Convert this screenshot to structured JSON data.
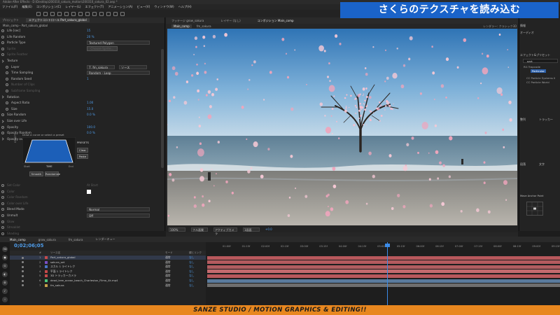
{
  "window": {
    "title": "Adobe After Effects - D:\\Desktop\\200310_sakura_motion\\200310_sakura_02.aep *"
  },
  "banner": {
    "text": "さくらのテクスチャを読み込む"
  },
  "menu": {
    "items": [
      "ファイル(F)",
      "編集(E)",
      "コンポジション(C)",
      "レイヤー(L)",
      "エフェクト(T)",
      "アニメーション(A)",
      "ビュー(V)",
      "ウィンドウ(W)",
      "ヘルプ(H)"
    ]
  },
  "effect_controls": {
    "tabs": [
      "プロジェクト",
      "エフェクトコントロール Part_sakura_global"
    ],
    "path": "Main_comp・Part_sakura_global",
    "rows": [
      {
        "label": "Life [sec]",
        "value": "15",
        "indent": 1
      },
      {
        "label": "Life Random",
        "value": "20 %",
        "indent": 1
      },
      {
        "label": "Particle Type",
        "dropdown": "Textured Polygon",
        "indent": 1
      },
      {
        "label": "Sprite",
        "button": "Choose Sprite...",
        "indent": 1,
        "dim": true
      },
      {
        "label": "Sprite Feather",
        "value": "",
        "indent": 1,
        "dim": true
      },
      {
        "label": "Texture",
        "value": "",
        "indent": 1,
        "twirl": true
      },
      {
        "label": "Layer",
        "dropdown": "7. fm_sakura",
        "dropdown2": "ソース",
        "indent": 2
      },
      {
        "label": "Time Sampling",
        "dropdown": "Random - Loop",
        "indent": 2
      },
      {
        "label": "Random Seed",
        "value": "1",
        "indent": 2
      },
      {
        "label": "Number of Clips",
        "value": "",
        "indent": 2,
        "dim": true
      },
      {
        "label": "Subframe Sampling",
        "value": "",
        "indent": 2,
        "dim": true
      },
      {
        "label": "Rotation",
        "value": "",
        "indent": 1,
        "twirl": true
      },
      {
        "label": "Aspect Ratio",
        "value": "1.00",
        "indent": 2
      },
      {
        "label": "Size",
        "value": "15.0",
        "indent": 2
      },
      {
        "label": "Size Random",
        "value": "0.0 %",
        "indent": 1
      },
      {
        "label": "Size over Life",
        "value": "",
        "indent": 1,
        "twirl": true
      },
      {
        "label": "Opacity",
        "value": "100.0",
        "indent": 1
      },
      {
        "label": "Opacity Random",
        "value": "0.0 %",
        "indent": 1
      },
      {
        "label": "Opacity over Life",
        "value": "",
        "indent": 1,
        "twirl": true
      }
    ],
    "curve": {
      "hint": "Draw a curve or select a preset",
      "presets_label": "PRESETS",
      "y_label": "OPACITY",
      "x_start": "Start",
      "x_mid": "TIME",
      "x_end": "End",
      "clear": "Clear",
      "paste": "Paste",
      "smooth": "Smooth",
      "randomize": "Randomize"
    },
    "lower_rows": [
      {
        "label": "Set Color",
        "value": "At Start",
        "dim": true
      },
      {
        "label": "Color",
        "swatch": "#ffffff",
        "dim": true
      },
      {
        "label": "Color Random",
        "value": "",
        "dim": true
      },
      {
        "label": "Color over Life",
        "value": "",
        "dim": true
      },
      {
        "label": "Blend Mode",
        "dropdown": "Normal"
      },
      {
        "label": "Unmult",
        "dropdown": "Off"
      },
      {
        "label": "Glow",
        "value": "",
        "dim": true
      },
      {
        "label": "Streaklet",
        "value": "",
        "dim": true
      },
      {
        "label": "Shading",
        "value": "",
        "dim": true
      },
      {
        "label": "Physics (Master)",
        "value": "",
        "dim": true
      }
    ]
  },
  "viewer": {
    "tabs": [
      "フッテージ grow_sakura",
      "レイヤー (なし)",
      "コンポジション Main_comp"
    ],
    "crumbs": [
      "Main_comp",
      "fm_sakura"
    ],
    "right_label": "レンダラー: クラシック3D",
    "controls": [
      "100%",
      "フル画質",
      "アクティブカメラ",
      "1画面",
      "+0.0"
    ]
  },
  "right_panels": {
    "info_label": "情報",
    "audio_label": "オーディオ",
    "effects_title": "エフェクト&プリセット",
    "search_value": "part",
    "effects_group": "RG Trapcode",
    "effects_items": [
      "Particular",
      "CC Particle Systems II",
      "CC Particle World"
    ],
    "align_label": "整列",
    "tracker_label": "トラッカー",
    "paragraph_label": "段落",
    "character_label": "文字",
    "anchor_label": "Move Anchor Point"
  },
  "timeline": {
    "tabs": [
      "Main_comp",
      "grow_sakura",
      "fm_sakura",
      "レンダーキュー"
    ],
    "timecode": "0;02;06;05",
    "header": [
      "#",
      "ソース名",
      "モード",
      "親とリンク"
    ],
    "layers": [
      {
        "num": "1",
        "name": "Part_sakura_global",
        "color": "#c74a4a",
        "mode": "通常",
        "parent": "なし"
      },
      {
        "num": "2",
        "name": "sakura_set",
        "color": "#7a4ec4",
        "mode": "通常",
        "parent": "なし"
      },
      {
        "num": "3",
        "name": "スカル 1 ライトレク",
        "color": "#4a74c7",
        "mode": "通常",
        "parent": "なし"
      },
      {
        "num": "4",
        "name": "平面 1 ライトレク",
        "color": "#c74a4a",
        "mode": "通常",
        "parent": "なし"
      },
      {
        "num": "5",
        "name": "3D トラッカーカメラ",
        "color": "#c74a4a",
        "mode": "通常",
        "parent": "なし"
      },
      {
        "num": "6",
        "name": "dead_tree_ocean_beach_Charleston_Filmo_4k.mp4",
        "color": "#4ac77a",
        "mode": "通常",
        "parent": "なし"
      },
      {
        "num": "7",
        "name": "fm_sakura",
        "color": "#c7a24a",
        "mode": "通常",
        "parent": "なし"
      }
    ],
    "ruler": [
      "01:00f",
      "01:15f",
      "02:00f",
      "02:15f",
      "03:00f",
      "03:15f",
      "04:00f",
      "04:15f",
      "05:00f",
      "05:15f",
      "06:00f",
      "06:15f",
      "07:00f",
      "07:15f",
      "08:00f",
      "08:15f",
      "09:00f",
      "09:15f"
    ],
    "playhead_fraction": 0.51,
    "bar_colors": [
      "#b8585c",
      "#b45a5e",
      "#b15d60",
      "#c36a6e",
      "#b8585c",
      "#5a7a9c",
      "#6e6e6e"
    ]
  },
  "footer": {
    "text": "SANZE STUDIO  / MOTION GRAPHICS & EDITING!!"
  }
}
